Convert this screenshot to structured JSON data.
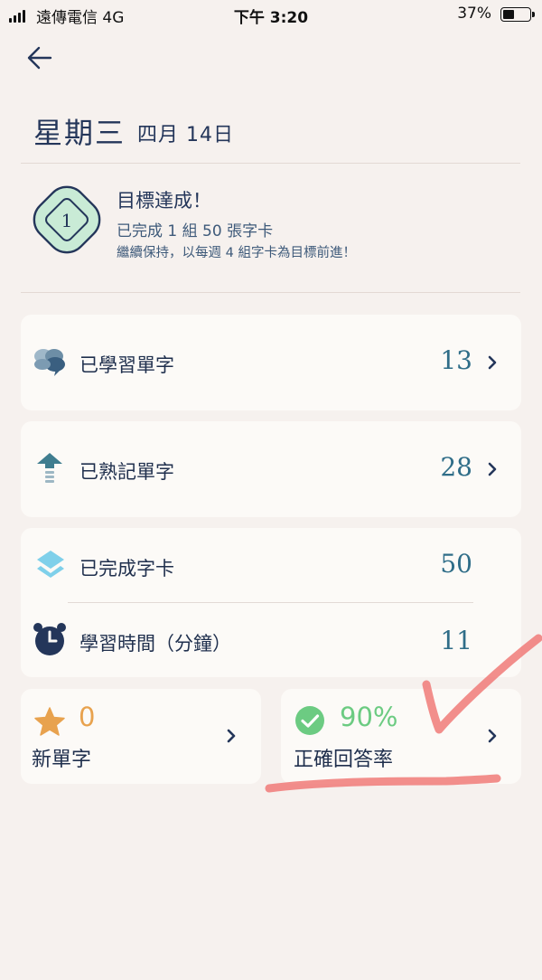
{
  "status_bar": {
    "carrier": "遠傳電信  4G",
    "time": "下午 3:20",
    "battery": "37%",
    "battery_level": 0.37
  },
  "header": {
    "weekday": "星期三",
    "date": "四月 14日"
  },
  "goal": {
    "badge_number": "1",
    "title": "目標達成！",
    "line1": "已完成 1 組 50 張字卡",
    "line2": "繼續保持，以每週 4 組字卡為目標前進！"
  },
  "stats": {
    "learned": {
      "label": "已學習單字",
      "value": "13",
      "icon": "brain-icon"
    },
    "memorized": {
      "label": "已熟記單字",
      "value": "28",
      "icon": "upload-arrow-icon"
    },
    "completed": {
      "label": "已完成字卡",
      "value": "50",
      "icon": "layers-icon"
    },
    "time": {
      "label": "學習時間（分鐘）",
      "value": "11",
      "icon": "alarm-clock-icon"
    }
  },
  "tiles": {
    "new_words": {
      "value": "0",
      "label": "新單字",
      "icon": "star-icon"
    },
    "accuracy": {
      "value": "90%",
      "label": "正確回答率",
      "icon": "check-circle-icon"
    }
  },
  "colors": {
    "background": "#f6f1ee",
    "card": "#fcfaf7",
    "navy": "#24365a",
    "teal": "#2f6d88",
    "badge_green": "#c9ebd6",
    "star_orange": "#e8a24e",
    "check_green": "#6ccb82",
    "annotation_red": "#f07a78"
  }
}
